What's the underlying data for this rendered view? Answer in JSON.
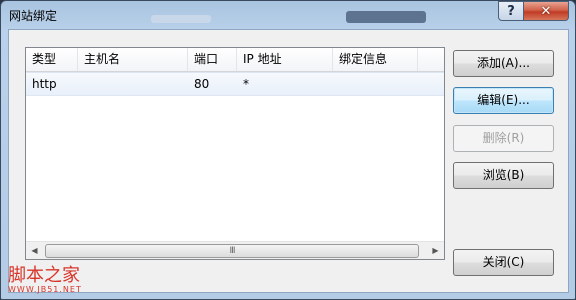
{
  "window": {
    "title": "网站绑定",
    "help_glyph": "?",
    "close_glyph": "✕"
  },
  "list": {
    "columns": [
      "类型",
      "主机名",
      "端口",
      "IP 地址",
      "绑定信息"
    ],
    "rows": [
      {
        "type": "http",
        "host": "",
        "port": "80",
        "ip": "*",
        "info": ""
      }
    ],
    "scroll_left": "◀",
    "scroll_right": "▶",
    "grip": "III"
  },
  "buttons": {
    "add": "添加(A)...",
    "edit": "编辑(E)...",
    "remove": "删除(R)",
    "browse": "浏览(B)",
    "close": "关闭(C)"
  },
  "watermark": {
    "main": "脚本之家",
    "url": "WWW.JB51.NET"
  },
  "colors": {
    "close_red": "#c13b25",
    "watermark_red": "#d8352a",
    "focus_blue": "#3c7fb1"
  }
}
